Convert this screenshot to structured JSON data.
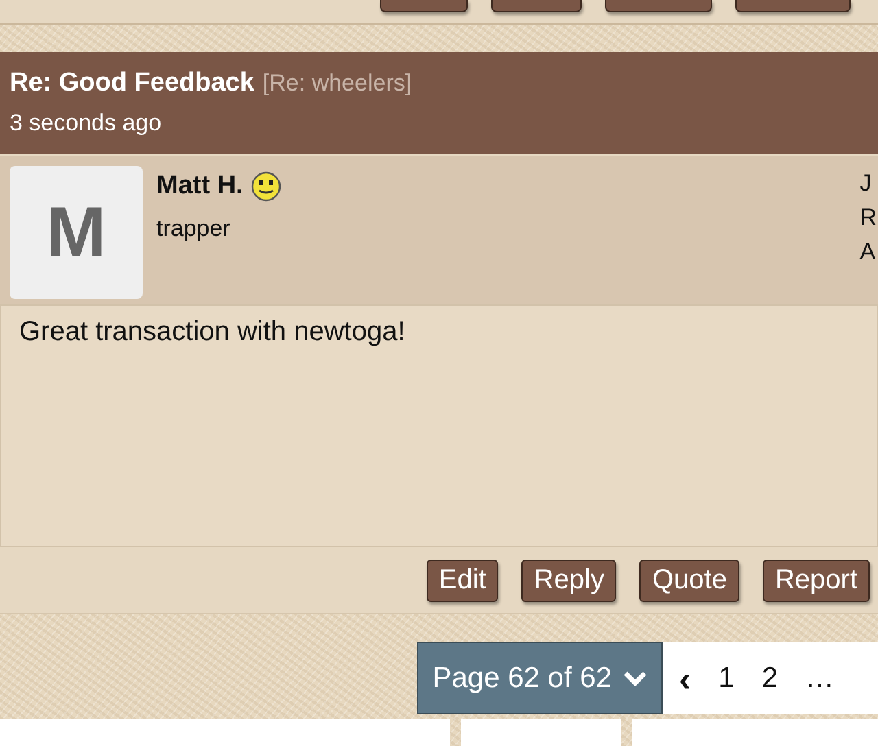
{
  "top_buttons": [
    {
      "kind": "cut"
    },
    {
      "kind": "cut"
    },
    {
      "kind": "cut"
    },
    {
      "kind": "cut"
    }
  ],
  "post": {
    "title": "Re: Good Feedback",
    "context": "[Re: wheelers]",
    "time": "3 seconds ago",
    "author": {
      "initial": "M",
      "name": "Matt H.",
      "rank": "trapper"
    },
    "side_info": [
      "J",
      "R",
      "A"
    ],
    "body": "Great transaction with newtoga!",
    "actions": [
      "Edit",
      "Reply",
      "Quote",
      "Report"
    ]
  },
  "pagination": {
    "current": "Page 62 of 62",
    "prev": "‹",
    "pages": [
      {
        "label": "1",
        "selected": false
      },
      {
        "label": "2",
        "selected": false
      }
    ],
    "ellipsis": "…"
  }
}
